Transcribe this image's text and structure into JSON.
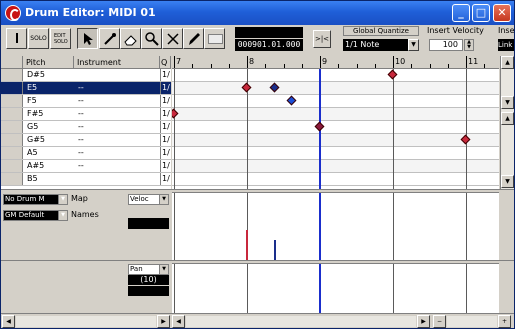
{
  "window": {
    "title": "Drum Editor: MIDI 01",
    "minimize": "_",
    "maximize": "□",
    "close": "✕"
  },
  "toolbar": {
    "solo_label": "SOLO",
    "tools": [
      "arrow-tool",
      "drumstick-tool",
      "eraser-tool",
      "magnifier-tool",
      "mute-tool",
      "pencil-tool"
    ],
    "position_value": "000901.01.000",
    "snap_label": ">|<",
    "global_quantize_label": "Global Quantize",
    "quantize_value": "1/1 Note",
    "insert_velocity_label": "Insert Velocity",
    "insert_velocity_value": "100",
    "insert_label": "Inse",
    "link_label": "Link"
  },
  "list": {
    "headers": {
      "pitch": "Pitch",
      "instrument": "Instrument",
      "q": "Q"
    },
    "rows": [
      {
        "pitch": "D#5",
        "instrument": "",
        "q": "1/"
      },
      {
        "pitch": "E5",
        "instrument": "--",
        "q": "1/",
        "selected": true
      },
      {
        "pitch": "F5",
        "instrument": "--",
        "q": "1/"
      },
      {
        "pitch": "F#5",
        "instrument": "--",
        "q": "1/"
      },
      {
        "pitch": "G5",
        "instrument": "--",
        "q": "1/"
      },
      {
        "pitch": "G#5",
        "instrument": "--",
        "q": "1/"
      },
      {
        "pitch": "A5",
        "instrument": "--",
        "q": "1/"
      },
      {
        "pitch": "A#5",
        "instrument": "--",
        "q": "1/"
      },
      {
        "pitch": "B5",
        "instrument": "",
        "q": "1/"
      }
    ]
  },
  "ruler": {
    "labels": [
      "7",
      "8",
      "9",
      "10",
      "11"
    ]
  },
  "notes": [
    {
      "row": 0,
      "bar": 10.0,
      "color": "#c8283c"
    },
    {
      "row": 1,
      "bar": 8.0,
      "color": "#c8283c"
    },
    {
      "row": 1,
      "bar": 8.38,
      "color": "#1a2e8c"
    },
    {
      "row": 2,
      "bar": 8.62,
      "color": "#1a4ed8"
    },
    {
      "row": 3,
      "bar": 7.0,
      "color": "#c8283c"
    },
    {
      "row": 4,
      "bar": 9.0,
      "color": "#8c1a3c"
    },
    {
      "row": 5,
      "bar": 11.0,
      "color": "#c8283c"
    }
  ],
  "cursor_bar": 9.0,
  "lower_left": {
    "drum_map_value": "No Drum M",
    "map_label": "Map",
    "names_value": "GM Default",
    "names_label": "Names"
  },
  "velocity_lane": {
    "controller_label": "Veloc",
    "events": [
      {
        "bar": 8.0,
        "value": 60,
        "color": "#c8283c"
      },
      {
        "bar": 8.38,
        "value": 40,
        "color": "#1a2e8c"
      }
    ]
  },
  "pan_lane": {
    "controller_label": "Pan",
    "value": "(10)"
  },
  "colors": {
    "selection": "#0a246a",
    "cursor": "#1a2ecc",
    "title_bar": "#1f5fd8"
  }
}
